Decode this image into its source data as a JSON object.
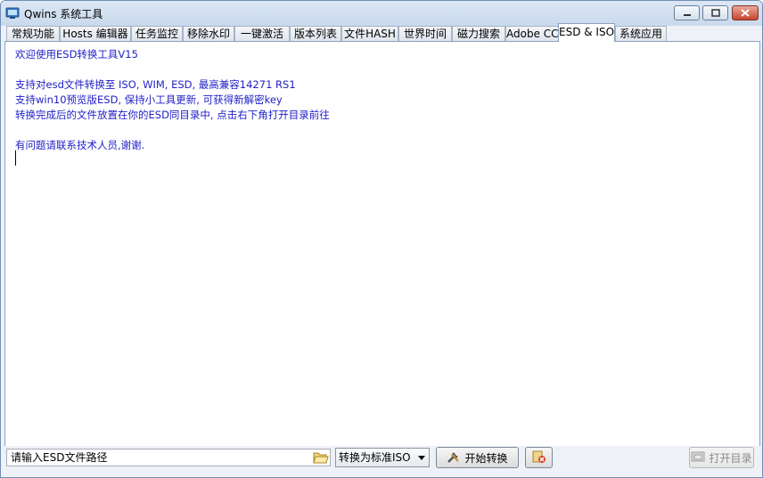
{
  "window": {
    "title": "Qwins 系统工具",
    "icons": {
      "app": "app-icon",
      "minimize": "minimize-icon",
      "maximize": "maximize-icon",
      "close": "close-icon"
    }
  },
  "tabs": [
    {
      "label": "常规功能",
      "active": false
    },
    {
      "label": "Hosts 编辑器",
      "active": false
    },
    {
      "label": "任务监控",
      "active": false
    },
    {
      "label": "移除水印",
      "active": false
    },
    {
      "label": "一键激活",
      "active": false
    },
    {
      "label": "版本列表",
      "active": false
    },
    {
      "label": "文件HASH",
      "active": false
    },
    {
      "label": "世界时间",
      "active": false
    },
    {
      "label": "磁力搜索",
      "active": false
    },
    {
      "label": "Adobe CC",
      "active": false
    },
    {
      "label": "ESD & ISO",
      "active": true
    },
    {
      "label": "系统应用",
      "active": false
    }
  ],
  "content": {
    "text_color": "#2121c9",
    "lines": [
      "欢迎使用ESD转换工具V15",
      "",
      "支持对esd文件转换至 ISO, WIM, ESD, 最高兼容14271 RS1",
      "支持win10预览版ESD, 保持小工具更新, 可获得新解密key",
      "转换完成后的文件放置在你的ESD同目录中, 点击右下角打开目录前往",
      "",
      "有问题请联系技术人员,谢谢."
    ]
  },
  "bottom": {
    "path_input": {
      "value": "",
      "placeholder": "请输入ESD文件路径"
    },
    "browse_icon": "folder-open-icon",
    "convert_select": {
      "selected": "转换为标准ISO"
    },
    "start_button": {
      "label": "开始转换",
      "icon": "tools-icon"
    },
    "cancel_button": {
      "icon": "cancel-icon"
    },
    "open_dir_button": {
      "label": "打开目录",
      "icon": "folder-icon",
      "disabled": true
    }
  }
}
